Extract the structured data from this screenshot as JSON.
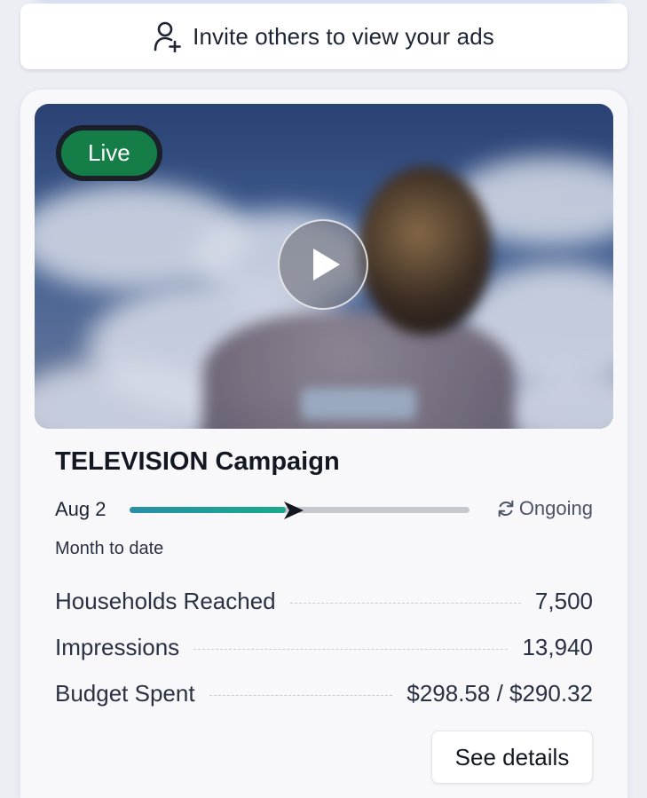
{
  "invite": {
    "label": "Invite others to view your ads",
    "icon": "add-user-icon"
  },
  "campaign": {
    "status_badge": "Live",
    "status_color": "#157d48",
    "media_icon": "play-icon",
    "title": "TELEVISION Campaign",
    "start_date": "Aug 2",
    "progress_fraction": 0.46,
    "end_label": "Ongoing",
    "end_icon": "refresh-icon",
    "period_label": "Month to date",
    "stats": [
      {
        "label": "Households Reached",
        "value": "7,500"
      },
      {
        "label": "Impressions",
        "value": "13,940"
      },
      {
        "label": "Budget Spent",
        "value": "$298.58 / $290.32"
      }
    ],
    "details_button": "See details"
  }
}
